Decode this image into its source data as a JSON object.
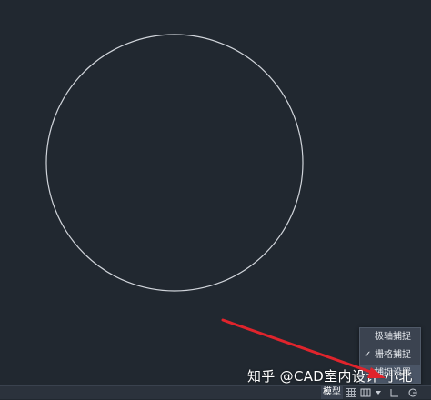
{
  "snap_menu": {
    "items": [
      {
        "label": "极轴捕捉",
        "checked": false
      },
      {
        "label": "栅格捕捉",
        "checked": true
      },
      {
        "label": "捕捉设置",
        "checked": false
      }
    ],
    "check_mark": "✓"
  },
  "status_bar": {
    "model_tab": "模型",
    "icons": [
      "grid-icon",
      "snap-icon",
      "dropdown-arrow-icon",
      "ortho-icon",
      "polar-icon"
    ]
  },
  "watermark": "知乎 @CAD室内设计-小北",
  "colors": {
    "canvas": "#212830",
    "circle": "#d0d4da",
    "annotation_arrow": "#e0242c"
  }
}
